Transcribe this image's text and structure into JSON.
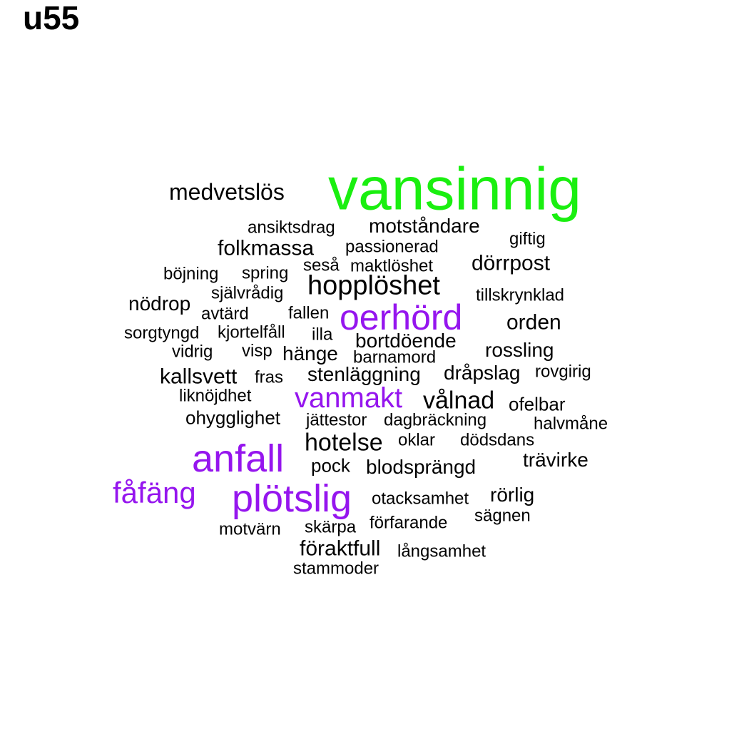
{
  "title": "u55",
  "colors": {
    "top": "#1aef10",
    "high": "#9515ee",
    "normal": "#000000"
  },
  "words": [
    {
      "text": "vansinnig",
      "tier": "top"
    },
    {
      "text": "medvetslös",
      "tier": "normal"
    },
    {
      "text": "ansiktsdrag",
      "tier": "normal"
    },
    {
      "text": "motståndare",
      "tier": "normal"
    },
    {
      "text": "giftig",
      "tier": "normal"
    },
    {
      "text": "folkmassa",
      "tier": "normal"
    },
    {
      "text": "passionerad",
      "tier": "normal"
    },
    {
      "text": "böjning",
      "tier": "normal"
    },
    {
      "text": "spring",
      "tier": "normal"
    },
    {
      "text": "seså",
      "tier": "normal"
    },
    {
      "text": "maktlöshet",
      "tier": "normal"
    },
    {
      "text": "dörrpost",
      "tier": "normal"
    },
    {
      "text": "självrådig",
      "tier": "normal"
    },
    {
      "text": "hopplöshet",
      "tier": "normal"
    },
    {
      "text": "tillskrynklad",
      "tier": "normal"
    },
    {
      "text": "nödrop",
      "tier": "normal"
    },
    {
      "text": "avtärd",
      "tier": "normal"
    },
    {
      "text": "fallen",
      "tier": "normal"
    },
    {
      "text": "oerhörd",
      "tier": "high"
    },
    {
      "text": "orden",
      "tier": "normal"
    },
    {
      "text": "sorgtyngd",
      "tier": "normal"
    },
    {
      "text": "kjortelfåll",
      "tier": "normal"
    },
    {
      "text": "illa",
      "tier": "normal"
    },
    {
      "text": "bortdöende",
      "tier": "normal"
    },
    {
      "text": "vidrig",
      "tier": "normal"
    },
    {
      "text": "visp",
      "tier": "normal"
    },
    {
      "text": "hänge",
      "tier": "normal"
    },
    {
      "text": "barnamord",
      "tier": "normal"
    },
    {
      "text": "rossling",
      "tier": "normal"
    },
    {
      "text": "kallsvett",
      "tier": "normal"
    },
    {
      "text": "fras",
      "tier": "normal"
    },
    {
      "text": "stenläggning",
      "tier": "normal"
    },
    {
      "text": "dråpslag",
      "tier": "normal"
    },
    {
      "text": "rovgirig",
      "tier": "normal"
    },
    {
      "text": "liknöjdhet",
      "tier": "normal"
    },
    {
      "text": "vanmakt",
      "tier": "high"
    },
    {
      "text": "vålnad",
      "tier": "normal"
    },
    {
      "text": "ofelbar",
      "tier": "normal"
    },
    {
      "text": "ohygglighet",
      "tier": "normal"
    },
    {
      "text": "jättestor",
      "tier": "normal"
    },
    {
      "text": "dagbräckning",
      "tier": "normal"
    },
    {
      "text": "halvmåne",
      "tier": "normal"
    },
    {
      "text": "hotelse",
      "tier": "normal"
    },
    {
      "text": "oklar",
      "tier": "normal"
    },
    {
      "text": "dödsdans",
      "tier": "normal"
    },
    {
      "text": "anfall",
      "tier": "high"
    },
    {
      "text": "trävirke",
      "tier": "normal"
    },
    {
      "text": "pock",
      "tier": "normal"
    },
    {
      "text": "blodsprängd",
      "tier": "normal"
    },
    {
      "text": "fåfäng",
      "tier": "high"
    },
    {
      "text": "plötslig",
      "tier": "high"
    },
    {
      "text": "otacksamhet",
      "tier": "normal"
    },
    {
      "text": "rörlig",
      "tier": "normal"
    },
    {
      "text": "sägnen",
      "tier": "normal"
    },
    {
      "text": "motvärn",
      "tier": "normal"
    },
    {
      "text": "skärpa",
      "tier": "normal"
    },
    {
      "text": "förfarande",
      "tier": "normal"
    },
    {
      "text": "föraktfull",
      "tier": "normal"
    },
    {
      "text": "långsamhet",
      "tier": "normal"
    },
    {
      "text": "stammoder",
      "tier": "normal"
    }
  ]
}
